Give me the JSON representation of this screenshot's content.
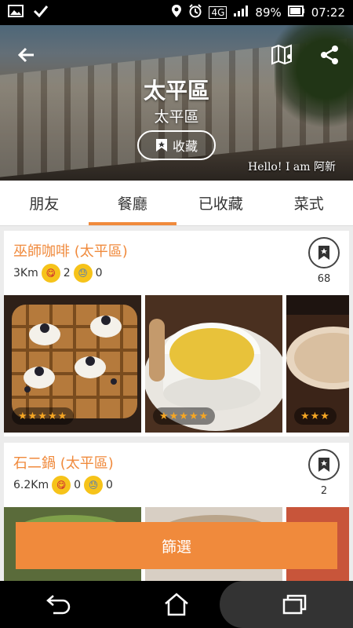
{
  "status_bar": {
    "network": "4G",
    "battery": "89%",
    "time": "07:22"
  },
  "hero": {
    "title": "太平區",
    "subtitle": "太平區",
    "favorite_label": "收藏",
    "watermark": "Hello! I am 阿新"
  },
  "tabs": [
    {
      "label": "朋友",
      "active": false
    },
    {
      "label": "餐廳",
      "active": true
    },
    {
      "label": "已收藏",
      "active": false
    },
    {
      "label": "菜式",
      "active": false
    }
  ],
  "restaurants": [
    {
      "name": "巫師咖啡 (太平區)",
      "distance": "3Km",
      "happy_count": "2",
      "sad_count": "0",
      "bookmark_count": "68",
      "photos": [
        {
          "rating": "★★★★★"
        },
        {
          "rating": "★★★★★"
        },
        {
          "rating": "★★★"
        }
      ]
    },
    {
      "name": "石二鍋 (太平區)",
      "distance": "6.2Km",
      "happy_count": "0",
      "sad_count": "0",
      "bookmark_count": "2"
    }
  ],
  "filter_button": {
    "label": "篩選"
  },
  "colors": {
    "accent": "#f08a3c"
  }
}
